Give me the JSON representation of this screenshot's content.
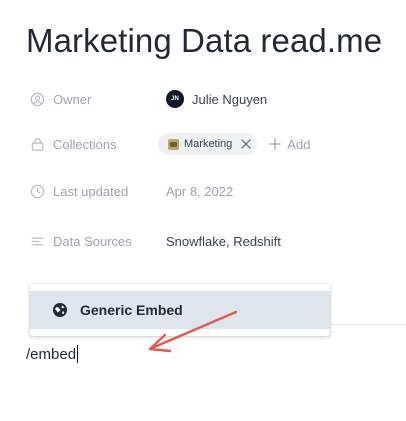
{
  "document": {
    "title": "Marketing Data read.me"
  },
  "properties": {
    "owner": {
      "label": "Owner",
      "avatar_initials": "JN",
      "value": "Julie Nguyen"
    },
    "collections": {
      "label": "Collections",
      "chip_label": "Marketing",
      "add_label": "Add"
    },
    "last_updated": {
      "label": "Last updated",
      "value": "Apr 8, 2022"
    },
    "data_sources": {
      "label": "Data Sources",
      "value": "Snowflake, Redshift"
    }
  },
  "slash_menu": {
    "item_label": "Generic Embed"
  },
  "editor": {
    "text": "/embed"
  },
  "colors": {
    "annotation_arrow": "#e05a4f",
    "menu_highlight": "#dfe5ec",
    "label_gray": "#9ca3af"
  }
}
